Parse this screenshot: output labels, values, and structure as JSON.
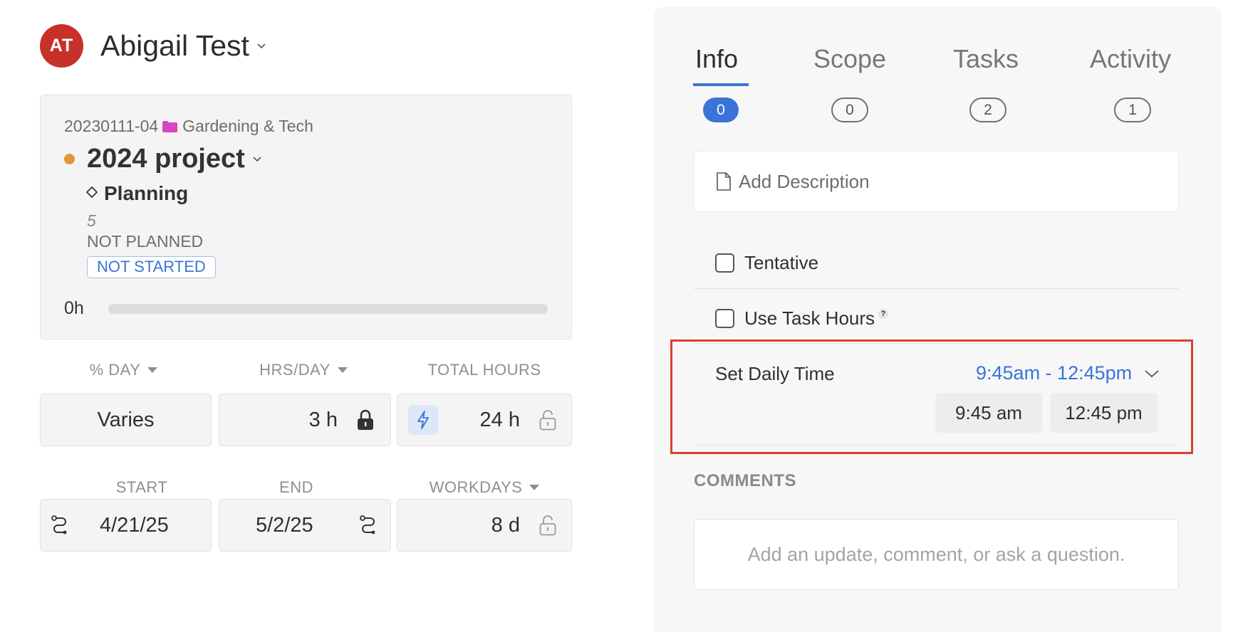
{
  "header": {
    "avatar_initials": "AT",
    "avatar_color": "#c8312a",
    "name": "Abigail Test"
  },
  "project_card": {
    "code": "20230111-04",
    "folder_icon": "folder-icon",
    "folder_color": "#d946c2",
    "client": "Gardening & Tech",
    "status_dot_color": "#e3963a",
    "title": "2024 project",
    "phase_icon": "diamond-icon",
    "phase": "Planning",
    "phase_number": "5",
    "plan_status": "NOT PLANNED",
    "status_badge": "NOT STARTED",
    "hours": "0h",
    "progress_fraction": 0
  },
  "fields": {
    "pct_day": {
      "label": "% DAY",
      "value": "Varies"
    },
    "hrs_day": {
      "label": "HRS/DAY",
      "value": "3 h"
    },
    "total_hours": {
      "label": "TOTAL HOURS",
      "value": "24 h"
    },
    "start": {
      "label": "START",
      "value": "4/21/25"
    },
    "end": {
      "label": "END",
      "value": "5/2/25"
    },
    "workdays": {
      "label": "WORKDAYS",
      "value": "8 d"
    }
  },
  "tabs": [
    {
      "label": "Info",
      "count": "0",
      "active": true
    },
    {
      "label": "Scope",
      "count": "0",
      "active": false
    },
    {
      "label": "Tasks",
      "count": "2",
      "active": false
    },
    {
      "label": "Activity",
      "count": "1",
      "active": false
    }
  ],
  "info": {
    "add_description": "Add Description",
    "tentative_label": "Tentative",
    "use_task_hours_label": "Use Task Hours",
    "help_glyph": "?",
    "daily_time_label": "Set Daily Time",
    "daily_time_range": "9:45am - 12:45pm",
    "start_time": "9:45 am",
    "end_time": "12:45 pm",
    "comments_label": "COMMENTS",
    "comment_placeholder": "Add an update, comment, or ask a question."
  },
  "colors": {
    "accent": "#3a74d7",
    "highlight_border": "#d8412f"
  }
}
